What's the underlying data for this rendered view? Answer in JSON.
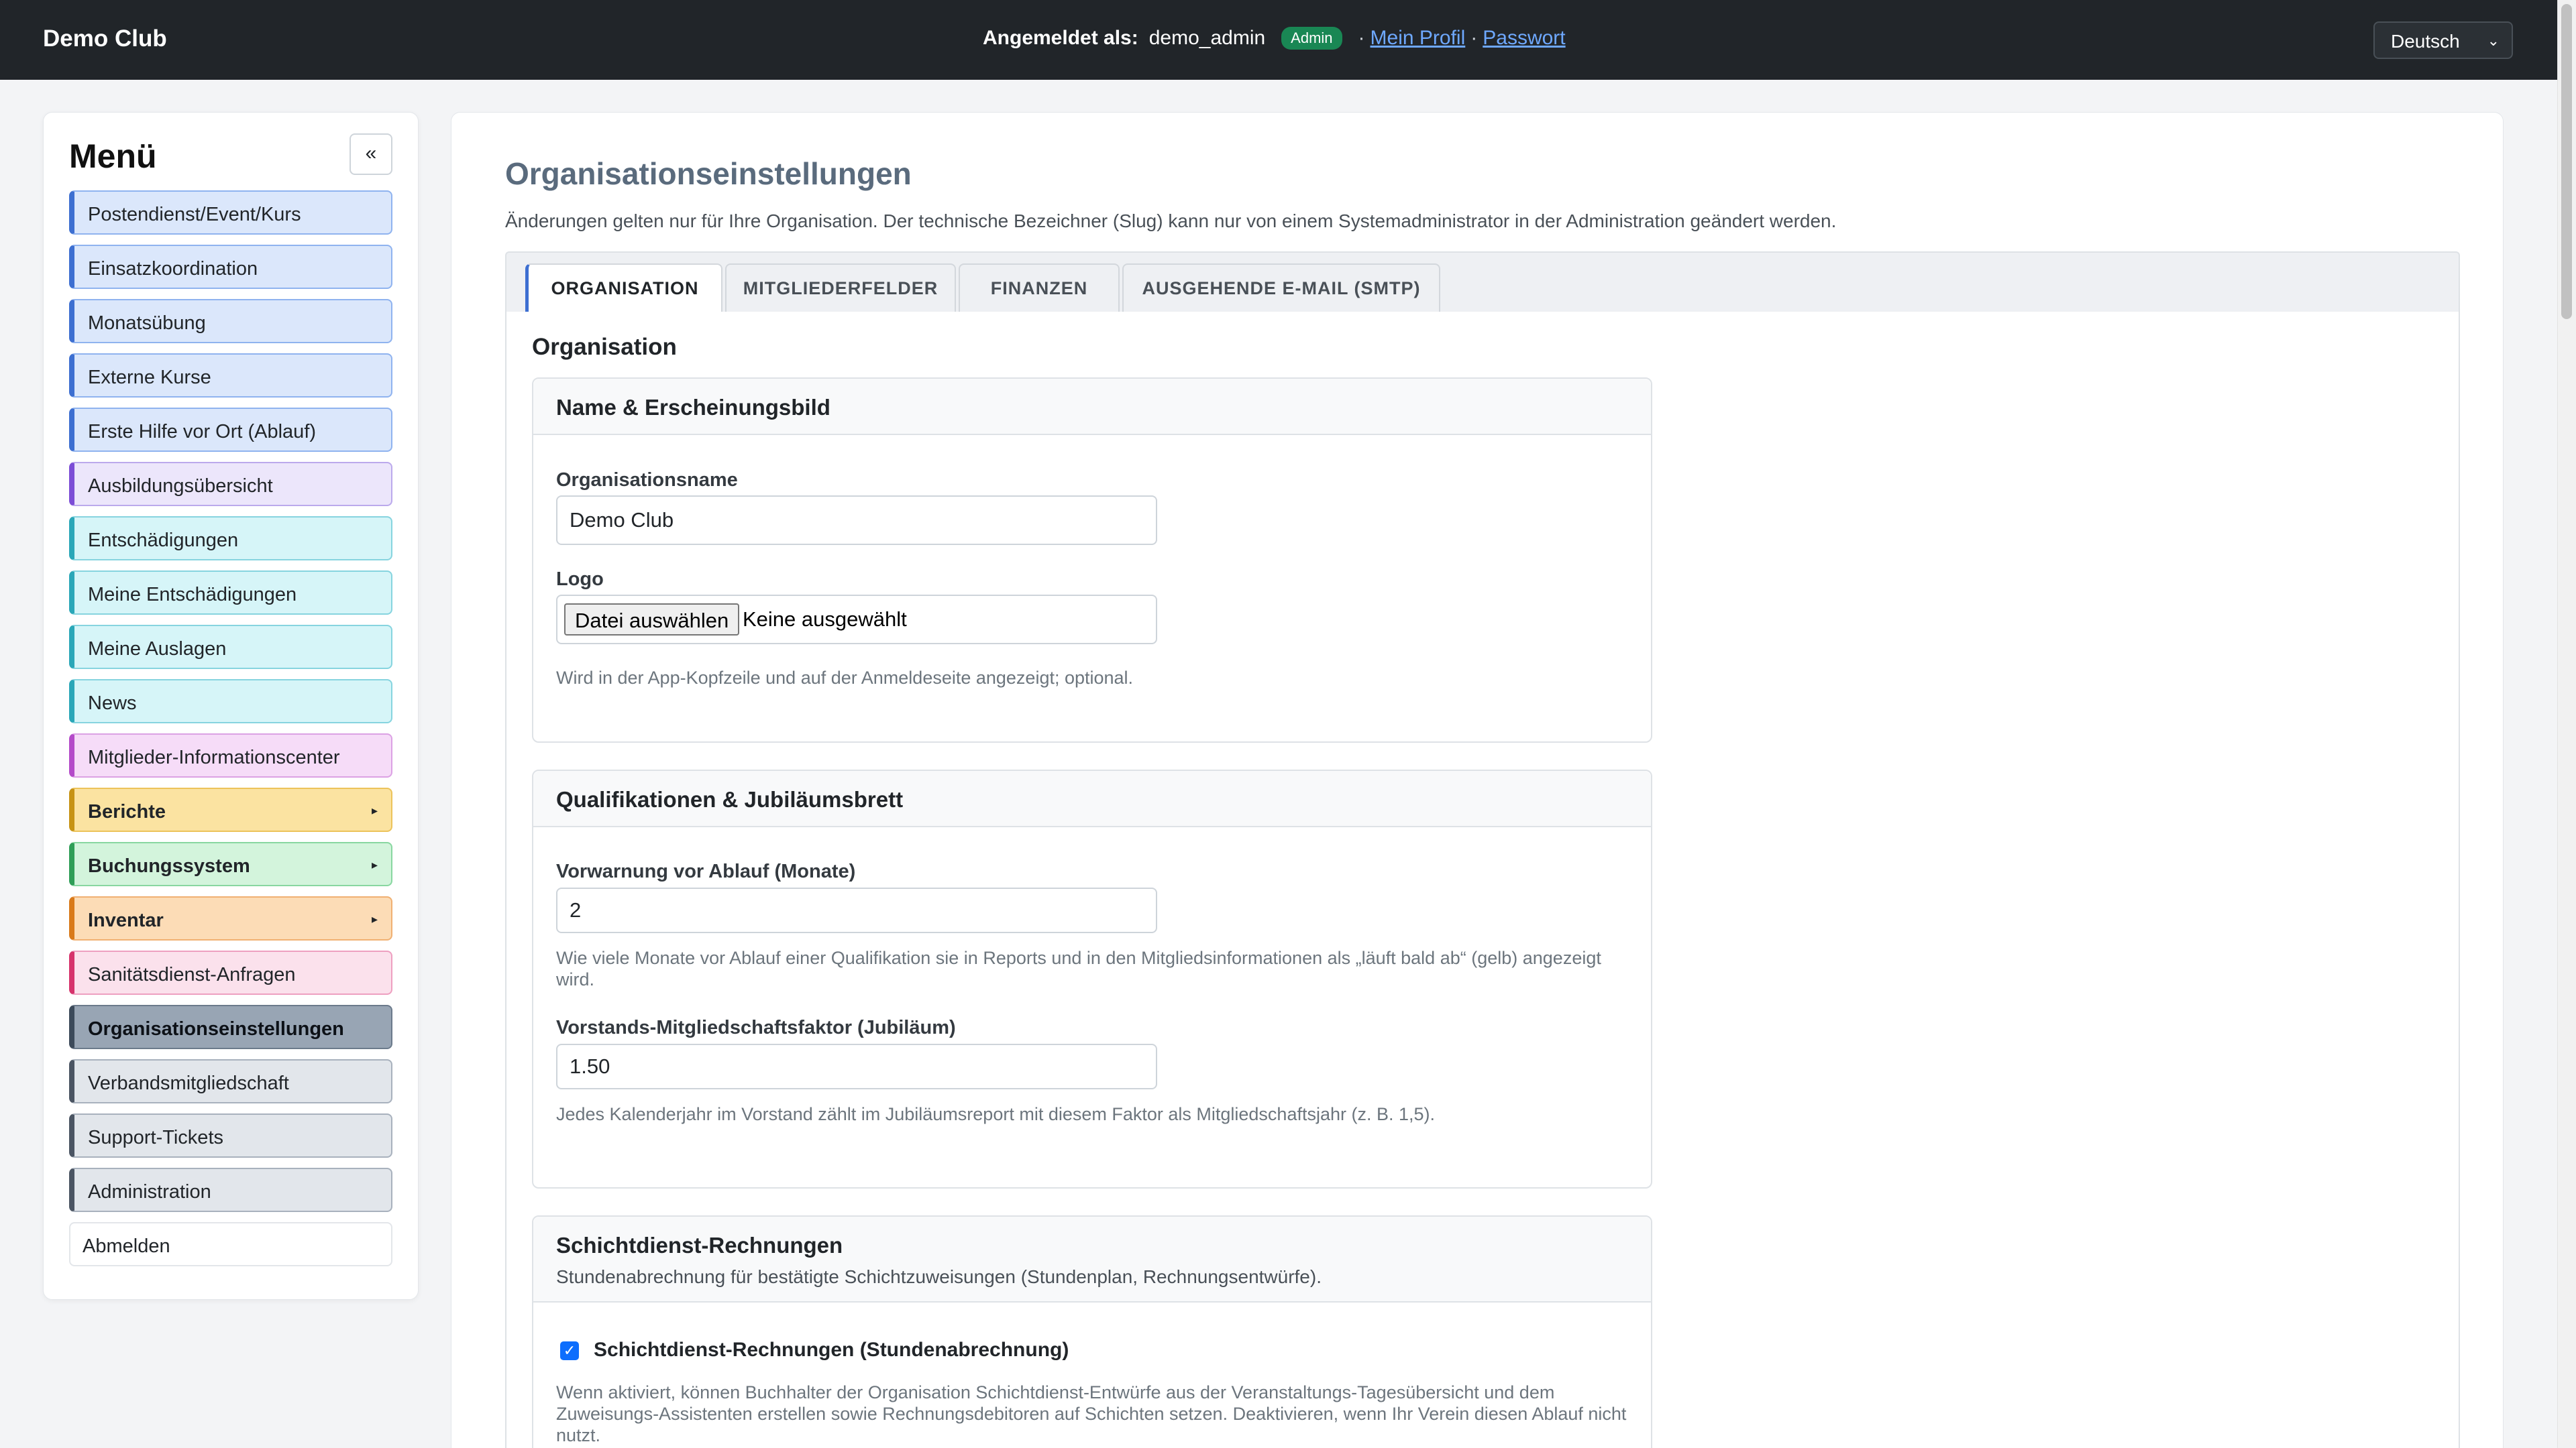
{
  "header": {
    "brand": "Demo Club",
    "logged_in_label": "Angemeldet als:",
    "username": "demo_admin",
    "role_badge": "Admin",
    "separator": "·",
    "profile_link": "Mein Profil",
    "password_link": "Passwort",
    "language": "Deutsch"
  },
  "sidebar": {
    "title": "Menü",
    "collapse_label": "«",
    "items": [
      {
        "label": "Postendienst/Event/Kurs"
      },
      {
        "label": "Einsatzkoordination"
      },
      {
        "label": "Monatsübung"
      },
      {
        "label": "Externe Kurse"
      },
      {
        "label": "Erste Hilfe vor Ort (Ablauf)"
      },
      {
        "label": "Ausbildungsübersicht"
      },
      {
        "label": "Entschädigungen"
      },
      {
        "label": "Meine Entschädigungen"
      },
      {
        "label": "Meine Auslagen"
      },
      {
        "label": "News"
      },
      {
        "label": "Mitglieder-Informationscenter"
      },
      {
        "label": "Berichte",
        "arrow": "▸"
      },
      {
        "label": "Buchungssystem",
        "arrow": "▸"
      },
      {
        "label": "Inventar",
        "arrow": "▸"
      },
      {
        "label": "Sanitätsdienst-Anfragen"
      },
      {
        "label": "Organisationseinstellungen"
      },
      {
        "label": "Verbandsmitgliedschaft"
      },
      {
        "label": "Support-Tickets"
      },
      {
        "label": "Administration"
      },
      {
        "label": "Abmelden"
      }
    ]
  },
  "main": {
    "title": "Organisationseinstellungen",
    "subtitle": "Änderungen gelten nur für Ihre Organisation. Der technische Bezeichner (Slug) kann nur von einem Systemadministrator in der Administration geändert werden.",
    "tabs": [
      {
        "label": "ORGANISATION",
        "active": true
      },
      {
        "label": "MITGLIEDERFELDER",
        "active": false
      },
      {
        "label": "FINANZEN",
        "active": false
      },
      {
        "label": "AUSGEHENDE E-MAIL (SMTP)",
        "active": false
      }
    ],
    "section_title": "Organisation",
    "card_name": {
      "title": "Name & Erscheinungsbild",
      "org_name_label": "Organisationsname",
      "org_name_value": "Demo Club",
      "logo_label": "Logo",
      "file_button": "Datei auswählen",
      "file_status": "Keine ausgewählt",
      "logo_help": "Wird in der App-Kopfzeile und auf der Anmeldeseite angezeigt; optional."
    },
    "card_quali": {
      "title": "Qualifikationen & Jubiläumsbrett",
      "warn_label": "Vorwarnung vor Ablauf (Monate)",
      "warn_value": "2",
      "warn_help": "Wie viele Monate vor Ablauf einer Qualifikation sie in Reports und in den Mitgliedsinformationen als „läuft bald ab“ (gelb) angezeigt wird.",
      "factor_label": "Vorstands-Mitgliedschaftsfaktor (Jubiläum)",
      "factor_value": "1.50",
      "factor_help": "Jedes Kalenderjahr im Vorstand zählt im Jubiläumsreport mit diesem Faktor als Mitgliedschaftsjahr (z. B. 1,5)."
    },
    "card_shift": {
      "title": "Schichtdienst-Rechnungen",
      "subtitle": "Stundenabrechnung für bestätigte Schichtzuweisungen (Stundenplan, Rechnungsentwürfe).",
      "checkbox_label": "Schichtdienst-Rechnungen (Stundenabrechnung)",
      "checkbox_checked": true,
      "help": "Wenn aktiviert, können Buchhalter der Organisation Schichtdienst-Entwürfe aus der Veranstaltungs-Tagesübersicht und dem Zuweisungs-Assistenten erstellen sowie Rechnungsdebitoren auf Schichten setzen. Deaktivieren, wenn Ihr Verein diesen Ablauf nicht nutzt."
    }
  }
}
